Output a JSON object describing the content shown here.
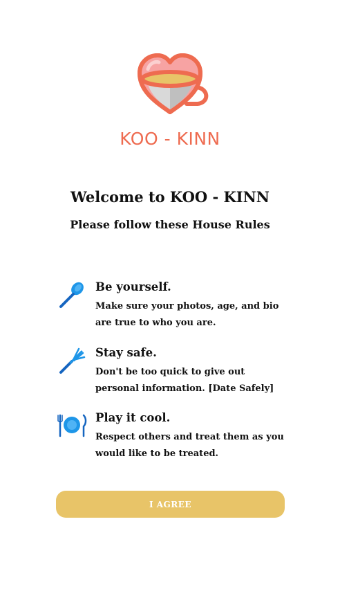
{
  "brand": {
    "name": "KOO - KINN",
    "accent_color": "#ee6b50",
    "logo_icon": "heart-teacup-icon"
  },
  "welcome": {
    "title": "Welcome to KOO - KINN",
    "subtitle": "Please follow these House Rules"
  },
  "rules": [
    {
      "icon": "spoon-icon",
      "title": "Be yourself.",
      "description": "Make sure your photos, age, and bio are true to who you are."
    },
    {
      "icon": "fork-icon",
      "title": "Stay safe.",
      "description": "Don't be too quick to give out personal information. [Date Safely]"
    },
    {
      "icon": "plate-cutlery-icon",
      "title": "Play it cool.",
      "description": "Respect others and treat them as you would like to be treated."
    }
  ],
  "agree_button": {
    "label": "I AGREE",
    "color": "#e8c468"
  }
}
